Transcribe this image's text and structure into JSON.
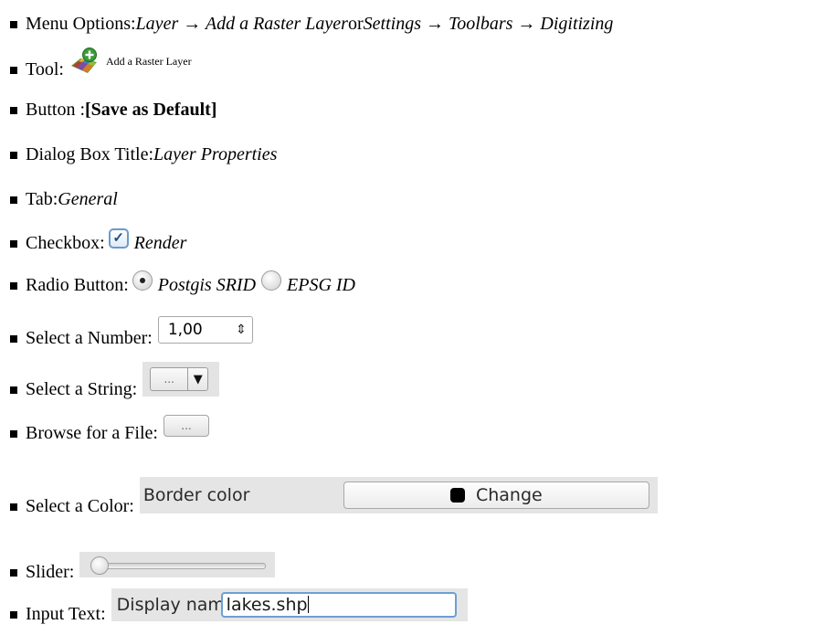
{
  "rows": {
    "menu": {
      "label": "Menu Options: ",
      "item1": "Layer → Add a Raster Layer",
      "or": " or ",
      "item2": "Settings → Toolbars → Digitizing"
    },
    "tool": {
      "label": "Tool: ",
      "icon": "add-raster-layer-icon",
      "caption": "Add a Raster Layer"
    },
    "button": {
      "label": "Button : ",
      "value": "[Save as Default]"
    },
    "dialog": {
      "label": "Dialog Box Title: ",
      "value": "Layer Properties"
    },
    "tab": {
      "label": "Tab: ",
      "value": "General"
    },
    "checkbox": {
      "label": "Checkbox: ",
      "value": "Render",
      "checked": true
    },
    "radio": {
      "label": "Radio Button: ",
      "option1": "Postgis SRID",
      "option2": "EPSG ID",
      "selected": "Postgis SRID"
    },
    "number": {
      "label": "Select a Number: ",
      "value": "1,00"
    },
    "string": {
      "label": "Select a String: ",
      "value": "..."
    },
    "file": {
      "label": "Browse for a File: ",
      "button": "..."
    },
    "color": {
      "label": "Select a Color: ",
      "field_label": "Border color",
      "button": "Change",
      "swatch_color": "#000000"
    },
    "slider": {
      "label": "Slider: ",
      "value_fraction": 0.0
    },
    "input": {
      "label": "Input Text: ",
      "field_label": "Display name",
      "value": "lakes.shp"
    }
  },
  "colors": {
    "checkbox_border": "#6b9ac9",
    "input_focus_border": "#6d9fd3",
    "widget_panel": "#e5e5e5"
  }
}
